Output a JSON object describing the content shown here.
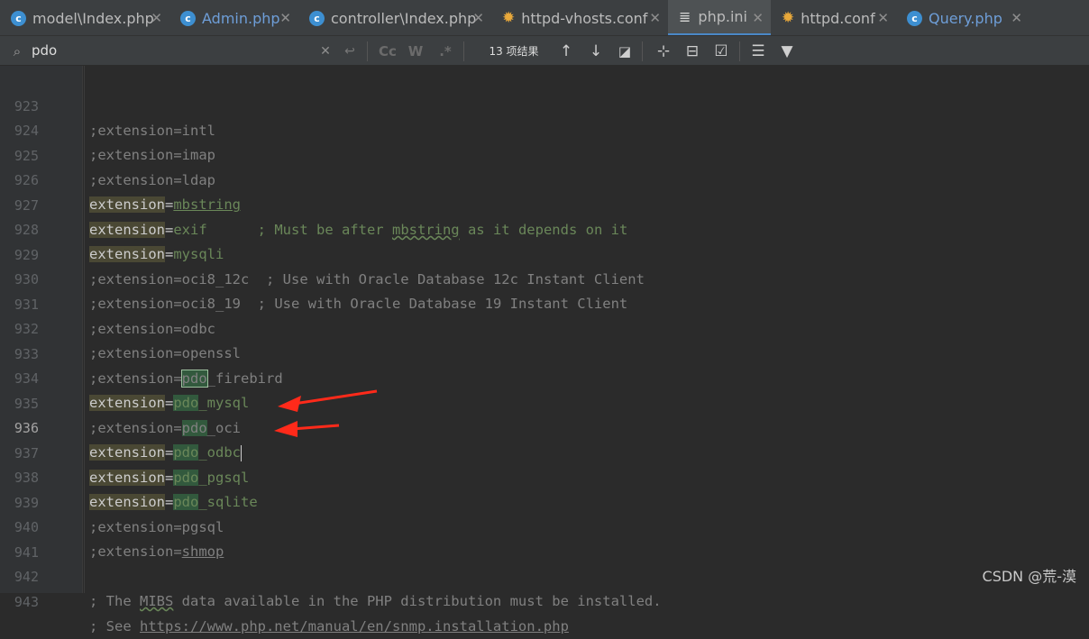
{
  "tabs": [
    {
      "label": "model\\Index.php",
      "icon": "php-class-icon",
      "active": false
    },
    {
      "label": "Admin.php",
      "icon": "php-class-icon",
      "active": false
    },
    {
      "label": "controller\\Index.php",
      "icon": "php-class-icon",
      "active": false
    },
    {
      "label": "httpd-vhosts.conf",
      "icon": "gear-icon",
      "active": false
    },
    {
      "label": "php.ini",
      "icon": "ini-file-icon",
      "active": true
    },
    {
      "label": "httpd.conf",
      "icon": "gear-icon",
      "active": false
    },
    {
      "label": "Query.php",
      "icon": "php-class-icon",
      "active": false
    }
  ],
  "search": {
    "query": "pdo",
    "results_label": "13 项结果",
    "case_label": "Cc",
    "word_label": "W",
    "regex_label": ".*"
  },
  "editor": {
    "current_line": "936",
    "lines": [
      {
        "n": "923",
        "t": ";extension=intl"
      },
      {
        "n": "924",
        "t": ";extension=imap"
      },
      {
        "n": "925",
        "t": ";extension=ldap"
      },
      {
        "n": "926",
        "t": "extension=mbstring"
      },
      {
        "n": "927",
        "t": "extension=exif      ; Must be after mbstring as it depends on it"
      },
      {
        "n": "928",
        "t": "extension=mysqli"
      },
      {
        "n": "929",
        "t": ";extension=oci8_12c  ; Use with Oracle Database 12c Instant Client"
      },
      {
        "n": "930",
        "t": ";extension=oci8_19  ; Use with Oracle Database 19 Instant Client"
      },
      {
        "n": "931",
        "t": ";extension=odbc"
      },
      {
        "n": "932",
        "t": ";extension=openssl"
      },
      {
        "n": "933",
        "t": ";extension=pdo_firebird"
      },
      {
        "n": "934",
        "t": "extension=pdo_mysql"
      },
      {
        "n": "935",
        "t": ";extension=pdo_oci"
      },
      {
        "n": "936",
        "t": "extension=pdo_odbc"
      },
      {
        "n": "937",
        "t": "extension=pdo_pgsql"
      },
      {
        "n": "938",
        "t": "extension=pdo_sqlite"
      },
      {
        "n": "939",
        "t": ";extension=pgsql"
      },
      {
        "n": "940",
        "t": ";extension=shmop"
      },
      {
        "n": "941",
        "t": ""
      },
      {
        "n": "942",
        "t": "; The MIBS data available in the PHP distribution must be installed."
      },
      {
        "n": "943",
        "t": "; See https://www.php.net/manual/en/snmp.installation.php"
      }
    ]
  },
  "segments": {
    "ext": "extension",
    "semi_ext": ";extension",
    "eq": "=",
    "pdo": "pdo",
    "intl": "intl",
    "imap": "imap",
    "ldap": "ldap",
    "mbstring": "mbstring",
    "exif": "exif",
    "exif_cmt_a": "      ; Must be after ",
    "exif_cmt_b": " as it depends on it",
    "mysqli": "mysqli",
    "oci12": "oci8_12c",
    "oci12_cmt": "  ; Use with Oracle Database 12c Instant Client",
    "oci19": "oci8_19",
    "oci19_cmt": "  ; Use with Oracle Database 19 Instant Client",
    "odbc": "odbc",
    "openssl": "openssl",
    "firebird": "_firebird",
    "mysql": "_mysql",
    "oci": "_oci",
    "odbc2": "_odbc",
    "pgsql2": "_pgsql",
    "sqlite": "_sqlite",
    "pgsql": "pgsql",
    "shmop": "shmop",
    "mibs_a": "; The ",
    "mibs": "MIBS",
    "mibs_b": " data available in the PHP distribution must be installed.",
    "see": "; See ",
    "url": "https://www.php.net/manual/en/snmp.installation.php"
  },
  "watermark": "CSDN @荒-漠",
  "colors": {
    "accent": "#4a88c7",
    "match_bg": "#32593d",
    "arrow": "#ff2a1a"
  }
}
